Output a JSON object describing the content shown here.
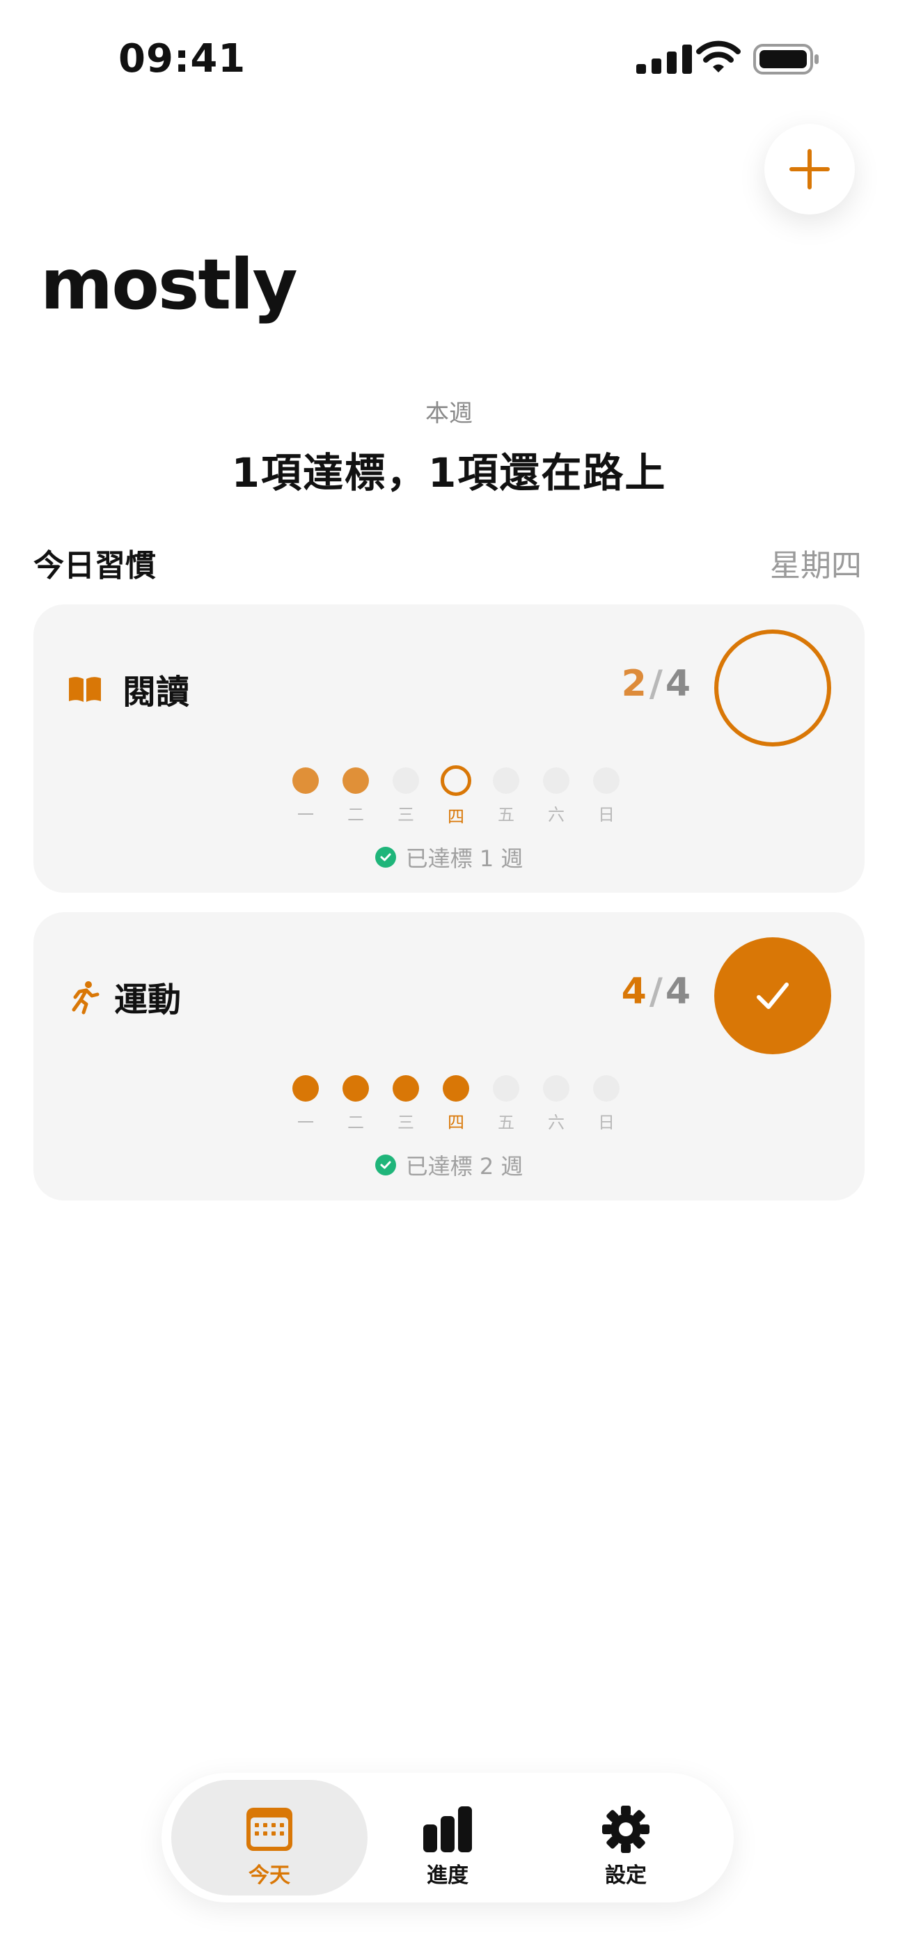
{
  "status_bar": {
    "time": "09:41"
  },
  "app": {
    "title": "mostly"
  },
  "week": {
    "label": "本週",
    "summary": "1項達標，1項還在路上"
  },
  "today": {
    "heading": "今日習慣",
    "weekday": "星期四"
  },
  "colors": {
    "accent": "#d97706",
    "success": "#1fb57a",
    "card_bg": "#f5f5f5"
  },
  "habits": [
    {
      "name": "閱讀",
      "icon": "book-icon",
      "done": "2",
      "slash": "/",
      "goal": "4",
      "completed_today": false,
      "days": [
        "一",
        "二",
        "三",
        "四",
        "五",
        "六",
        "日"
      ],
      "day_states": [
        "done",
        "done",
        "off",
        "today",
        "off",
        "off",
        "off"
      ],
      "streak": "已達標 1 週"
    },
    {
      "name": "運動",
      "icon": "running-icon",
      "done": "4",
      "slash": "/",
      "goal": "4",
      "completed_today": true,
      "days": [
        "一",
        "二",
        "三",
        "四",
        "五",
        "六",
        "日"
      ],
      "day_states": [
        "done",
        "done",
        "done",
        "done",
        "off",
        "off",
        "off"
      ],
      "streak": "已達標 2 週"
    }
  ],
  "tabs": [
    {
      "label": "今天",
      "icon": "calendar-icon",
      "active": true
    },
    {
      "label": "進度",
      "icon": "bar-chart-icon",
      "active": false
    },
    {
      "label": "設定",
      "icon": "gear-icon",
      "active": false
    }
  ]
}
